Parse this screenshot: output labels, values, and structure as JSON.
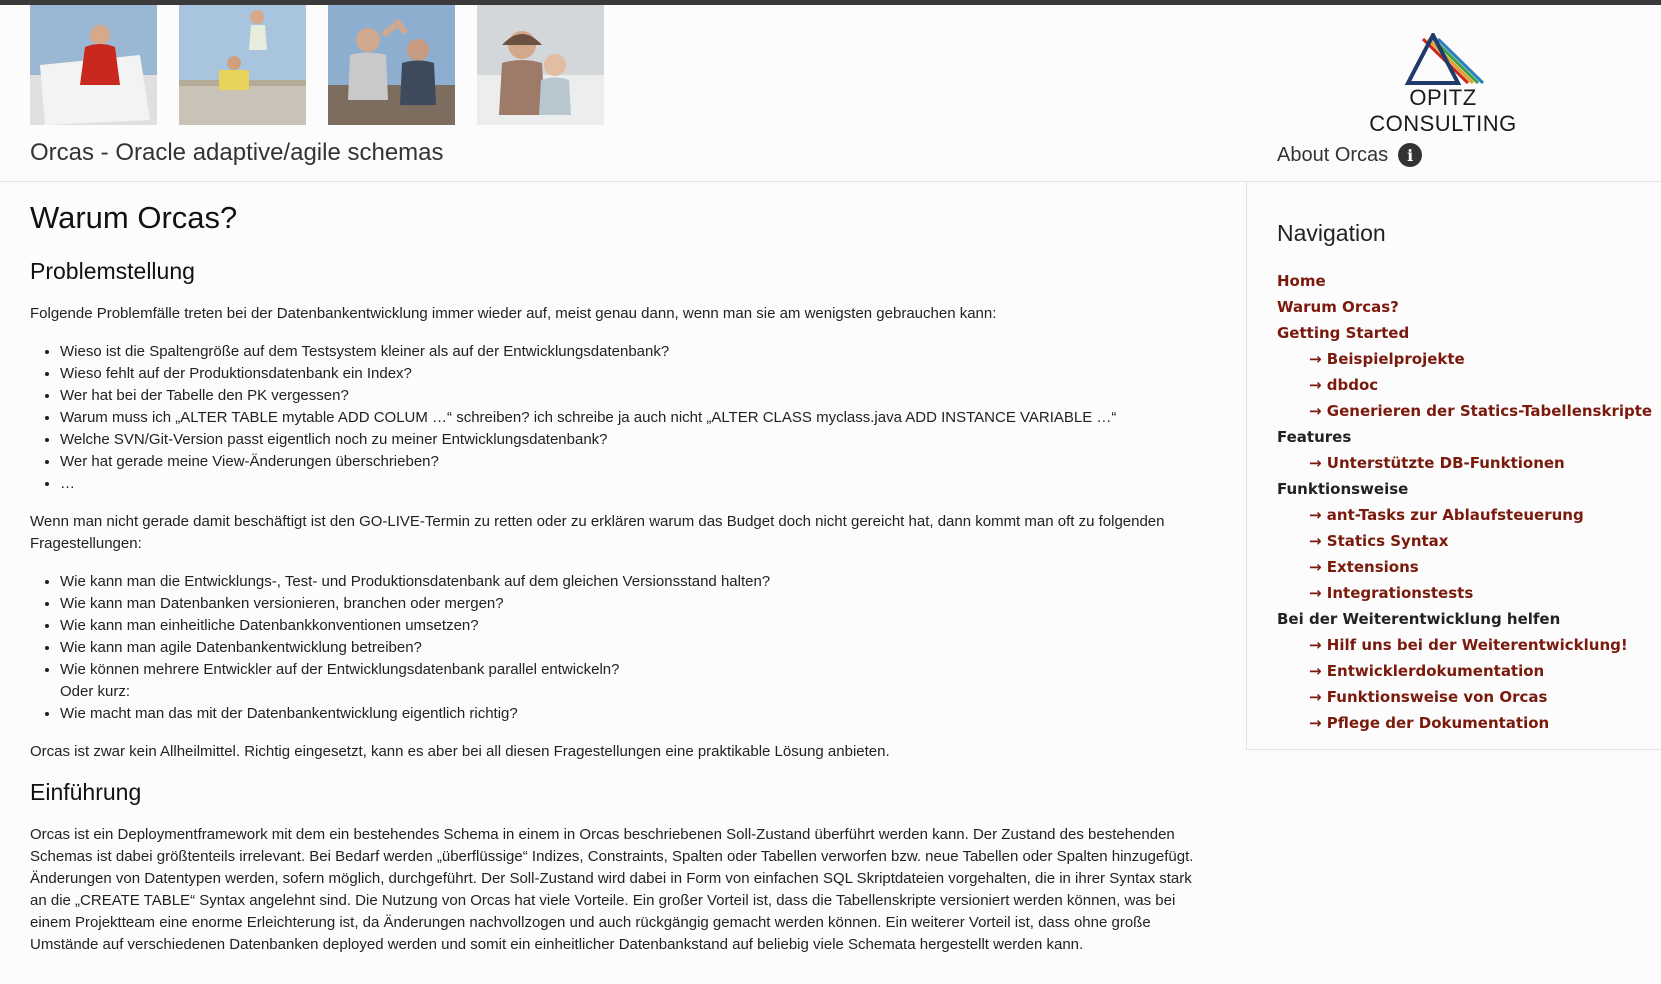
{
  "header": {
    "site_title": "Orcas - Oracle adaptive/agile schemas",
    "about_label": "About Orcas",
    "logo_text": "OPITZ CONSULTING",
    "info_icon": "i"
  },
  "main": {
    "h1": "Warum Orcas?",
    "sec1_title": "Problemstellung",
    "intro": "Folgende Problemfälle treten bei der Datenbankentwicklung immer wieder auf, meist genau dann, wenn man sie am wenigsten gebrauchen kann:",
    "problems": [
      "Wieso ist die Spaltengröße auf dem Testsystem kleiner als auf der Entwicklungsdatenbank?",
      "Wieso fehlt auf der Produktionsdatenbank ein Index?",
      "Wer hat bei der Tabelle den PK vergessen?",
      "Warum muss ich „ALTER TABLE mytable ADD COLUM …“ schreiben? ich schreibe ja auch nicht „ALTER CLASS myclass.java ADD INSTANCE VARIABLE …“",
      "Welche SVN/Git-Version passt eigentlich noch zu meiner Entwicklungsdatenbank?",
      "Wer hat gerade meine View-Änderungen überschrieben?",
      "…"
    ],
    "para2": "Wenn man nicht gerade damit beschäftigt ist den GO-LIVE-Termin zu retten oder zu erklären warum das Budget doch nicht gereicht hat, dann kommt man oft zu folgenden Fragestellungen:",
    "questions": [
      "Wie kann man die Entwicklungs-, Test- und Produktionsdatenbank auf dem gleichen Versionsstand halten?",
      "Wie kann man Datenbanken versionieren, branchen oder mergen?",
      "Wie kann man einheitliche Datenbankkonventionen umsetzen?",
      "Wie kann man agile Datenbankentwicklung betreiben?",
      "Wie können mehrere Entwickler auf der Entwicklungsdatenbank parallel entwickeln?"
    ],
    "questions_sub": "Oder kurz:",
    "question_last": "Wie macht man das mit der Datenbankentwicklung eigentlich richtig?",
    "para3": "Orcas ist zwar kein Allheilmittel. Richtig eingesetzt, kann es aber bei all diesen Fragestellungen eine praktikable Lösung anbieten.",
    "sec2_title": "Einführung",
    "para4": "Orcas ist ein Deploymentframework mit dem ein bestehendes Schema in einem in Orcas beschriebenen Soll-Zustand überführt werden kann. Der Zustand des bestehenden Schemas ist dabei größtenteils irrelevant. Bei Bedarf werden „überflüssige“ Indizes, Constraints, Spalten oder Tabellen verworfen bzw. neue Tabellen oder Spalten hinzugefügt. Änderungen von Datentypen werden, sofern möglich, durchgeführt. Der Soll-Zustand wird dabei in Form von einfachen SQL Skriptdateien vorgehalten, die in ihrer Syntax stark an die „CREATE TABLE“ Syntax angelehnt sind. Die Nutzung von Orcas hat viele Vorteile. Ein großer Vorteil ist, dass die Tabellenskripte versioniert werden können, was bei einem Projektteam eine enorme Erleichterung ist, da Änderungen nachvollzogen und auch rückgängig gemacht werden können. Ein weiterer Vorteil ist, dass ohne große Umstände auf verschiedenen Datenbanken deployed werden und somit ein einheitlicher Datenbankstand auf beliebig viele Schemata hergestellt werden kann."
  },
  "sidebar": {
    "title": "Navigation",
    "items": [
      {
        "label": "Home",
        "kind": "link"
      },
      {
        "label": "Warum Orcas?",
        "kind": "link"
      },
      {
        "label": "Getting Started",
        "kind": "link"
      },
      {
        "label": "→ Beispielprojekte",
        "kind": "sub"
      },
      {
        "label": "→ dbdoc",
        "kind": "sub"
      },
      {
        "label": "→ Generieren der Statics-Tabellenskripte",
        "kind": "sub"
      },
      {
        "label": "Features",
        "kind": "category"
      },
      {
        "label": "→ Unterstützte DB-Funktionen",
        "kind": "sub"
      },
      {
        "label": "Funktionsweise",
        "kind": "category"
      },
      {
        "label": "→ ant-Tasks zur Ablaufsteuerung",
        "kind": "sub"
      },
      {
        "label": "→ Statics Syntax",
        "kind": "sub"
      },
      {
        "label": "→ Extensions",
        "kind": "sub"
      },
      {
        "label": "→ Integrationstests",
        "kind": "sub"
      },
      {
        "label": "Bei der Weiterentwicklung helfen",
        "kind": "category"
      },
      {
        "label": "→ Hilf uns bei der Weiterentwicklung!",
        "kind": "sub"
      },
      {
        "label": "→ Entwicklerdokumentation",
        "kind": "sub"
      },
      {
        "label": "→ Funktionsweise von Orcas",
        "kind": "sub"
      },
      {
        "label": "→ Pflege der Dokumentation",
        "kind": "sub"
      }
    ]
  },
  "colors": {
    "link": "#7a1a0d",
    "category": "#222222",
    "top_bar": "#3a3a3a",
    "logo_blue": "#1f3b6b"
  }
}
